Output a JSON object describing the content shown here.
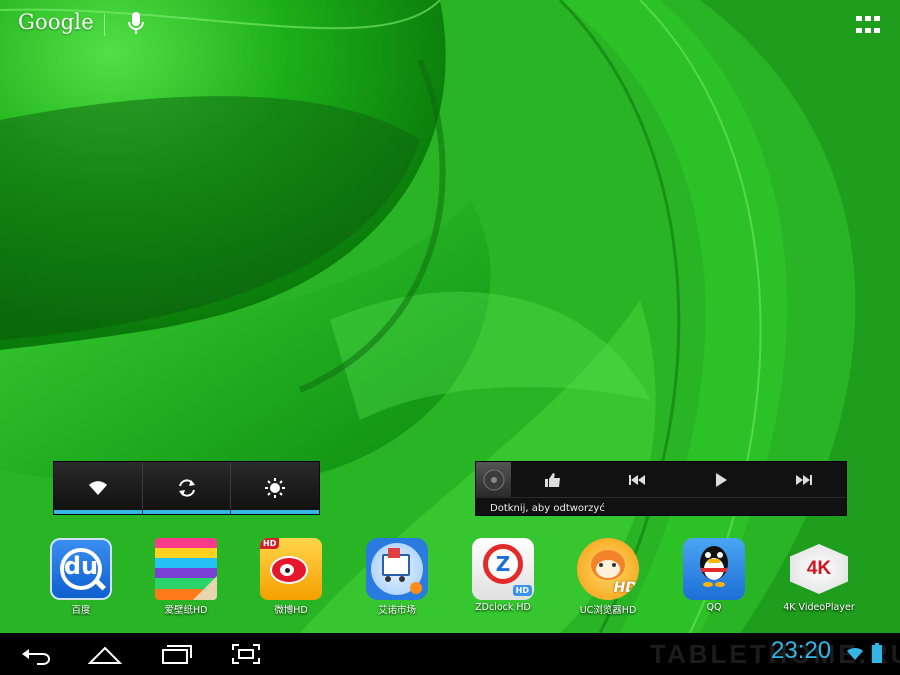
{
  "search": {
    "logo_text": "Google",
    "voice_icon": "mic-icon",
    "apps_icon": "all-apps-grid-icon"
  },
  "power_widget": {
    "buttons": [
      {
        "icon": "wifi-icon",
        "active": true
      },
      {
        "icon": "sync-icon",
        "active": true
      },
      {
        "icon": "brightness-icon",
        "active": true
      }
    ],
    "accent": "#35b5e5"
  },
  "music_widget": {
    "prompt": "Dotknij, aby odtworzyć",
    "controls": [
      "album-art-icon",
      "thumbs-up-icon",
      "previous-icon",
      "play-icon",
      "next-icon"
    ]
  },
  "apps": [
    {
      "label": "百度",
      "icon": "baidu-du-icon"
    },
    {
      "label": "爱壁纸HD",
      "icon": "wallpaper-icon"
    },
    {
      "label": "微博HD",
      "icon": "weibo-icon"
    },
    {
      "label": "艾诺市场",
      "icon": "market-cart-icon"
    },
    {
      "label": "ZDclock HD",
      "icon": "zdclock-icon"
    },
    {
      "label": "UC浏览器HD",
      "icon": "uc-browser-icon"
    },
    {
      "label": "QQ",
      "icon": "qq-penguin-icon"
    },
    {
      "label": "4K VideoPlayer",
      "icon": "4k-videoplayer-icon"
    }
  ],
  "app_badges": {
    "4k_text": "4K",
    "hd_text": "HD",
    "du_text": "du",
    "zd_text": "Z"
  },
  "navbar": {
    "buttons": [
      "back-icon",
      "home-icon",
      "recent-apps-icon",
      "screenshot-icon"
    ],
    "watermark": "TABLETHOME.RU",
    "time": "23:20"
  }
}
